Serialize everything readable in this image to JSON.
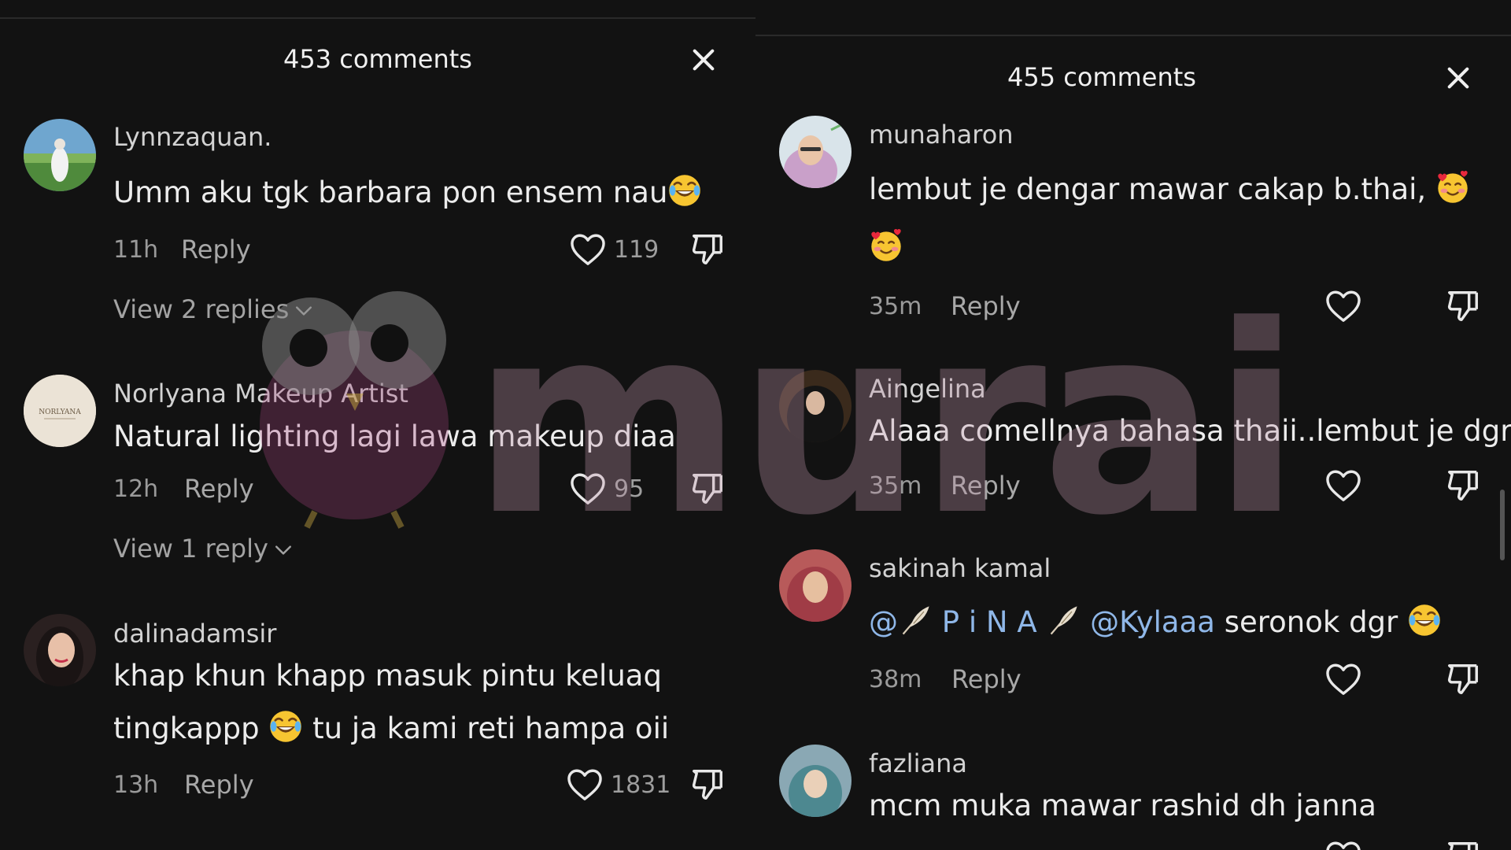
{
  "left": {
    "title": "453 comments",
    "comments": [
      {
        "user": "Lynnzaquan.",
        "text": "Umm aku tgk barbara pon ensem nau",
        "time": "11h",
        "reply": "Reply",
        "likes": "119",
        "view": "View 2 replies"
      },
      {
        "user": "Norlyana Makeup Artist",
        "avatar_text": "NORLYANA",
        "text": "Natural lighting lagi lawa makeup diaa",
        "time": "12h",
        "reply": "Reply",
        "likes": "95",
        "view": "View 1 reply"
      },
      {
        "user": "dalinadamsir",
        "text_line1": "khap khun khapp masuk pintu keluaq",
        "text_line2a": "tingkappp",
        "text_line2b": "tu ja kami reti hampa oii",
        "time": "13h",
        "reply": "Reply",
        "likes": "1831"
      }
    ]
  },
  "right": {
    "title": "455 comments",
    "comments": [
      {
        "user": "munaharon",
        "text": "lembut je dengar mawar cakap b.thai,",
        "time": "35m",
        "reply": "Reply"
      },
      {
        "user": "Aingelina",
        "text": "Alaaa comellnya bahasa thaii..lembut je dgr",
        "time": "35m",
        "reply": "Reply"
      },
      {
        "user": "sakinah kamal",
        "mention1": "@",
        "mention1b": "P i N A",
        "mention2": "@Kylaaa",
        "text": "seronok dgr",
        "time": "38m",
        "reply": "Reply"
      },
      {
        "user": "fazliana",
        "text": "mcm muka mawar rashid dh janna"
      }
    ]
  },
  "watermark": {
    "text": "murai"
  },
  "icons": {
    "close": "close-icon",
    "heart": "heart-icon",
    "dislike": "thumbs-down-icon",
    "chevron": "chevron-down-icon",
    "emoji_laugh": "face-with-tears-of-joy-icon",
    "emoji_hearts": "smiling-face-with-hearts-icon",
    "feather": "feather-icon"
  },
  "colors": {
    "background": "#121212",
    "mention": "#8fb7e8",
    "text": "#ececec",
    "muted": "#9a9a9a"
  }
}
